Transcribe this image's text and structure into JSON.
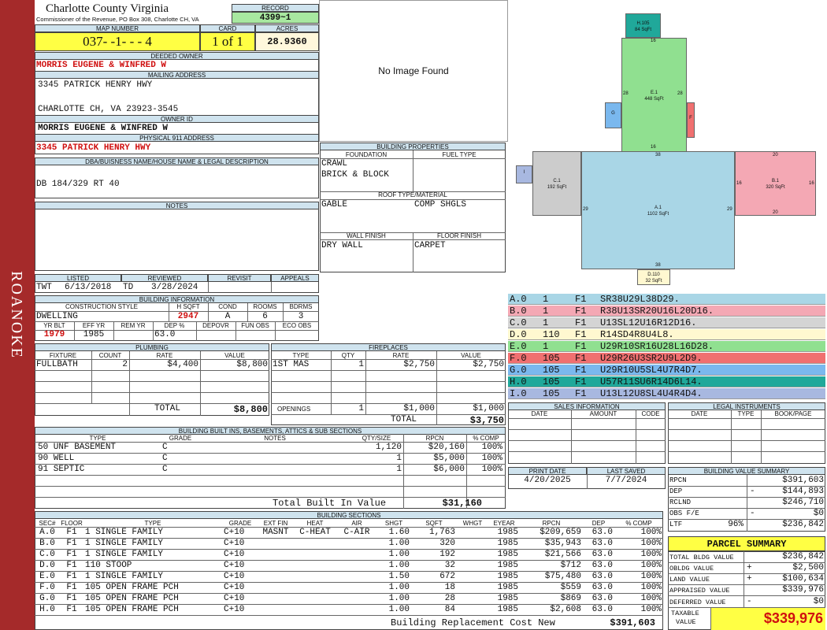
{
  "sidebar": {
    "label": "ROANOKE"
  },
  "header": {
    "county": "Charlotte County Virginia",
    "commissioner": "Commissioner of the Revenue, PO Box 308, Charlotte CH, VA",
    "record_label": "RECORD",
    "record": "4399~1",
    "map_label": "MAP NUMBER",
    "map_number": "037- -1- - - 4",
    "card_label": "CARD",
    "card": "1 of 1",
    "acres_label": "ACRES",
    "acres": "28.9360"
  },
  "owner": {
    "deeded_label": "DEEDED OWNER",
    "deeded": "MORRIS EUGENE & WINFRED W",
    "mailing_label": "MAILING ADDRESS",
    "mail1": "3345 PATRICK HENRY HWY",
    "mail2": "CHARLOTTE CH, VA 23923-3545",
    "ownerid_label": "OWNER ID",
    "ownerid": "MORRIS EUGENE & WINFRED W",
    "physical_label": "PHYSICAL 911 ADDRESS",
    "physical": "3345 PATRICK HENRY HWY",
    "dba_label": "DBA/BUISNESS NAME/HOUSE NAME & LEGAL DESCRIPTION",
    "legal": "DB 184/329 RT 40",
    "notes_label": "NOTES"
  },
  "image": {
    "text": "No Image Found"
  },
  "building_props": {
    "title": "BUILDING PROPERTIES",
    "foundation_label": "FOUNDATION",
    "fuel_label": "FUEL TYPE",
    "foundation1": "CRAWL",
    "foundation2": "BRICK & BLOCK",
    "roof_label": "ROOF TYPE/MATERIAL",
    "roof1": "GABLE",
    "roof2": "COMP SHGLS",
    "wall_label": "WALL FINISH",
    "floor_label": "FLOOR FINISH",
    "wall": "DRY WALL",
    "floor": "CARPET"
  },
  "listing": {
    "listed_label": "LISTED",
    "reviewed_label": "REVIEWED",
    "revisit_label": "REVISIT",
    "appeals_label": "APPEALS",
    "listed_by": "TWT",
    "listed": "6/13/2018",
    "reviewed_by": "TD",
    "reviewed": "3/28/2024"
  },
  "building_info": {
    "title": "BUILDING INFORMATION",
    "style_label": "CONSTRUCTION STYLE",
    "hsqft_label": "H SQFT",
    "cond_label": "COND",
    "rooms_label": "ROOMS",
    "bdrms_label": "BDRMS",
    "style": "DWELLING",
    "hsqft": "2947",
    "cond": "A",
    "rooms": "6",
    "bdrms": "3",
    "yrblt_label": "YR BLT",
    "effyr_label": "EFF YR",
    "remyr_label": "REM YR",
    "dep_label": "DEP %",
    "depovr_label": "DEPOVR",
    "funobs_label": "FUN OBS",
    "ecoobs_label": "ECO OBS",
    "yrblt": "1979",
    "effyr": "1985",
    "dep": "63.0"
  },
  "plumbing": {
    "title": "PLUMBING",
    "headers": [
      "FIXTURE",
      "COUNT",
      "RATE",
      "VALUE"
    ],
    "rows": [
      [
        "FULLBATH",
        "2",
        "$4,400",
        "$8,800"
      ]
    ],
    "total_label": "TOTAL",
    "total": "$8,800"
  },
  "fireplaces": {
    "title": "FIREPLACES",
    "headers": [
      "TYPE",
      "QTY",
      "RATE",
      "VALUE"
    ],
    "rows": [
      [
        "1ST MAS",
        "1",
        "$2,750",
        "$2,750"
      ]
    ],
    "openings_label": "OPENINGS",
    "openings_qty": "1",
    "openings_rate": "$1,000",
    "openings_value": "$1,000",
    "total_label": "TOTAL",
    "total": "$3,750"
  },
  "builtins": {
    "title": "BUILDING BUILT INS, BASEMENTS, ATTICS & SUB SECTIONS",
    "headers": [
      "TYPE",
      "GRADE",
      "NOTES",
      "QTY/SIZE",
      "RPCN",
      "% COMP"
    ],
    "rows": [
      [
        "50 UNF BASEMENT",
        "C",
        "",
        "1,120",
        "$20,160",
        "100%"
      ],
      [
        "90 WELL",
        "C",
        "",
        "1",
        "$5,000",
        "100%"
      ],
      [
        "91 SEPTIC",
        "C",
        "",
        "1",
        "$6,000",
        "100%"
      ]
    ],
    "total_label": "Total Built In Value",
    "total": "$31,160"
  },
  "sections": {
    "title": "BUILDING SECTIONS",
    "headers": [
      "SEC#",
      "FLOOR",
      "TYPE",
      "GRADE",
      "EXT FIN",
      "HEAT",
      "AIR",
      "SHGT",
      "SQFT",
      "WHGT",
      "EYEAR",
      "RPCN",
      "DEP",
      "% COMP"
    ],
    "rows": [
      [
        "A.0",
        "F1",
        "1 SINGLE FAMILY",
        "C+10",
        "MASNT",
        "C-HEAT",
        "C-AIR",
        "1.60",
        "1,763",
        "",
        "1985",
        "$209,659",
        "63.0",
        "100%"
      ],
      [
        "B.0",
        "F1",
        "1 SINGLE FAMILY",
        "C+10",
        "",
        "",
        "",
        "1.00",
        "320",
        "",
        "1985",
        "$35,943",
        "63.0",
        "100%"
      ],
      [
        "C.0",
        "F1",
        "1 SINGLE FAMILY",
        "C+10",
        "",
        "",
        "",
        "1.00",
        "192",
        "",
        "1985",
        "$21,566",
        "63.0",
        "100%"
      ],
      [
        "D.0",
        "F1",
        "110 STOOP",
        "C+10",
        "",
        "",
        "",
        "1.00",
        "32",
        "",
        "1985",
        "$712",
        "63.0",
        "100%"
      ],
      [
        "E.0",
        "F1",
        "1 SINGLE FAMILY",
        "C+10",
        "",
        "",
        "",
        "1.50",
        "672",
        "",
        "1985",
        "$75,480",
        "63.0",
        "100%"
      ],
      [
        "F.0",
        "F1",
        "105 OPEN FRAME PCH",
        "C+10",
        "",
        "",
        "",
        "1.00",
        "18",
        "",
        "1985",
        "$559",
        "63.0",
        "100%"
      ],
      [
        "G.0",
        "F1",
        "105 OPEN FRAME PCH",
        "C+10",
        "",
        "",
        "",
        "1.00",
        "28",
        "",
        "1985",
        "$869",
        "63.0",
        "100%"
      ],
      [
        "H.0",
        "F1",
        "105 OPEN FRAME PCH",
        "C+10",
        "",
        "",
        "",
        "1.00",
        "84",
        "",
        "1985",
        "$2,608",
        "63.0",
        "100%"
      ]
    ],
    "total_label": "Building Replacement Cost New",
    "total": "$391,603"
  },
  "sketch": {
    "labels": [
      {
        "id": "H",
        "name": "H.105",
        "area": "84 SqFt",
        "color": "#20a89a"
      },
      {
        "id": "E",
        "name": "E.1",
        "area": "448 SqFt",
        "color": "#90e090"
      },
      {
        "id": "G",
        "name": "G",
        "area": "",
        "color": "#7ab8ee"
      },
      {
        "id": "F",
        "name": "F",
        "area": "",
        "color": "#f07070"
      },
      {
        "id": "C",
        "name": "C.1",
        "area": "192 SqFt",
        "color": "#cccccc"
      },
      {
        "id": "A",
        "name": "A.1",
        "area": "1102 SqFt",
        "color": "#a9d6e6"
      },
      {
        "id": "B",
        "name": "B.1",
        "area": "320 SqFt",
        "color": "#f4a8b4"
      },
      {
        "id": "I",
        "name": "I",
        "area": "",
        "color": "#a8b8e0"
      },
      {
        "id": "D",
        "name": "D.110",
        "area": "32 SqFt",
        "color": "#fff8d0"
      }
    ],
    "dims": {
      "h_top": "16",
      "e_top": "16",
      "e_left": "28",
      "e_right": "28",
      "a_top": "38",
      "a_bottom": "38",
      "a_left": "29",
      "a_right": "29",
      "b_top": "20",
      "b_bottom": "20",
      "b_left": "16",
      "b_right": "16"
    }
  },
  "vectors": [
    {
      "sec": "A.0",
      "n": "1",
      "fl": "F1",
      "code": "SR38U29L38D29.",
      "color": "#a9d6e6"
    },
    {
      "sec": "B.0",
      "n": "1",
      "fl": "F1",
      "code": "R38U13SR20U16L20D16.",
      "color": "#f4a8b4"
    },
    {
      "sec": "C.0",
      "n": "1",
      "fl": "F1",
      "code": "U13SL12U16R12D16.",
      "color": "#d4d4d4"
    },
    {
      "sec": "D.0",
      "n": "110",
      "fl": "F1",
      "code": "R14SD4R8U4L8.",
      "color": "#fff8d0"
    },
    {
      "sec": "E.0",
      "n": "1",
      "fl": "F1",
      "code": "U29R10SR16U28L16D28.",
      "color": "#90e090"
    },
    {
      "sec": "F.0",
      "n": "105",
      "fl": "F1",
      "code": "U29R26U3SR2U9L2D9.",
      "color": "#f07070"
    },
    {
      "sec": "G.0",
      "n": "105",
      "fl": "F1",
      "code": "U29R10U5SL4U7R4D7.",
      "color": "#7ab8ee"
    },
    {
      "sec": "H.0",
      "n": "105",
      "fl": "F1",
      "code": "U57R11SU6R14D6L14.",
      "color": "#20a89a"
    },
    {
      "sec": "I.0",
      "n": "105",
      "fl": "F1",
      "code": "U13L12U8SL4U4R4D4.",
      "color": "#a8b8e0"
    }
  ],
  "sales": {
    "title": "SALES INFORMATION",
    "date_label": "DATE",
    "amount_label": "AMOUNT",
    "code_label": "CODE"
  },
  "legal": {
    "title": "LEGAL INSTRUMENTS",
    "date_label": "DATE",
    "type_label": "TYPE",
    "book_label": "BOOK/PAGE"
  },
  "dates": {
    "print_label": "PRINT DATE",
    "saved_label": "LAST SAVED",
    "print": "4/20/2025",
    "saved": "7/7/2024"
  },
  "value_summary": {
    "title": "BUILDING VALUE SUMMARY",
    "rpcn_label": "RPCN",
    "rpcn": "$391,603",
    "dep_label": "DEP",
    "dep_sign": "-",
    "dep": "$144,893",
    "rclnd_label": "RCLND",
    "rclnd": "$246,710",
    "obs_label": "OBS F/E",
    "obs_sign": "-",
    "obs": "$0",
    "ltf_label": "LTF",
    "ltf_pct": "96%",
    "ltf": "$236,842"
  },
  "parcel": {
    "title": "PARCEL SUMMARY",
    "bldg_label": "TOTAL BLDG VALUE",
    "bldg": "$236,842",
    "obldg_label": "OBLDG VALUE",
    "obldg_sign": "+",
    "obldg": "$2,500",
    "land_label": "LAND VALUE",
    "land_sign": "+",
    "land": "$100,634",
    "appraised_label": "APPRAISED VALUE",
    "appraised": "$339,976",
    "deferred_label": "DEFERRED VALUE",
    "deferred_sign": "-",
    "deferred": "$0",
    "taxable_label1": "TAXABLE",
    "taxable_label2": "VALUE",
    "taxable": "$339,976"
  }
}
